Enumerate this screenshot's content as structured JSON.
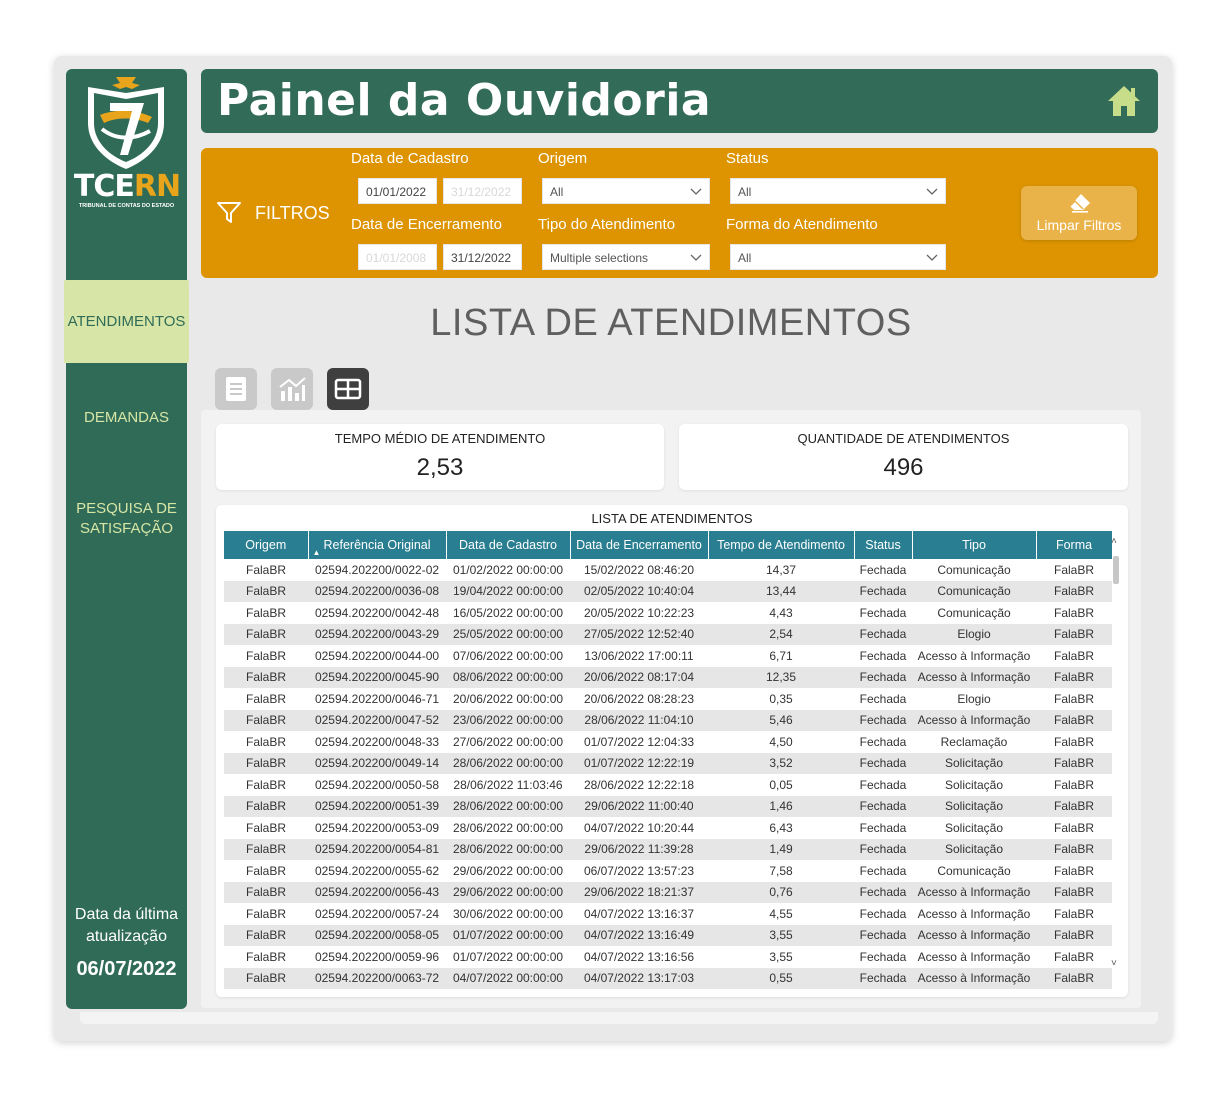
{
  "sidebar": {
    "brand_tce": "TCE",
    "brand_rn": "RN",
    "brand_sub": "TRIBUNAL DE CONTAS DO ESTADO",
    "nav": {
      "atendimentos": "ATENDIMENTOS",
      "demandas": "DEMANDAS",
      "pesquisa_line1": "PESQUISA DE",
      "pesquisa_line2": "SATISFAÇÃO"
    },
    "update_line1": "Data da última",
    "update_line2": "atualização",
    "update_date": "06/07/2022"
  },
  "header": {
    "title": "Painel da Ouvidoria",
    "home_icon": "home-icon"
  },
  "filters": {
    "title": "FILTROS",
    "data_cadastro_label": "Data de Cadastro",
    "data_cadastro_from": "01/01/2022",
    "data_cadastro_to": "31/12/2022",
    "data_encerramento_label": "Data de Encerramento",
    "data_encerramento_from": "01/01/2008",
    "data_encerramento_to": "31/12/2022",
    "origem_label": "Origem",
    "origem_value": "All",
    "tipo_label": "Tipo do Atendimento",
    "tipo_value": "Multiple selections",
    "status_label": "Status",
    "status_value": "All",
    "forma_label": "Forma do Atendimento",
    "forma_value": "All",
    "clear_button": "Limpar Filtros"
  },
  "page_title": "LISTA DE ATENDIMENTOS",
  "kpis": {
    "tempo_label": "TEMPO MÉDIO DE ATENDIMENTO",
    "tempo_value": "2,53",
    "quantidade_label": "QUANTIDADE DE ATENDIMENTOS",
    "quantidade_value": "496"
  },
  "table": {
    "title": "LISTA DE ATENDIMENTOS",
    "columns": [
      "Origem",
      "Referência Original",
      "Data de Cadastro",
      "Data de Encerramento",
      "Tempo de Atendimento",
      "Status",
      "Tipo",
      "Forma"
    ],
    "rows": [
      [
        "FalaBR",
        "02594.202200/0022-02",
        "01/02/2022 00:00:00",
        "15/02/2022 08:46:20",
        "14,37",
        "Fechada",
        "Comunicação",
        "FalaBR"
      ],
      [
        "FalaBR",
        "02594.202200/0036-08",
        "19/04/2022 00:00:00",
        "02/05/2022 10:40:04",
        "13,44",
        "Fechada",
        "Comunicação",
        "FalaBR"
      ],
      [
        "FalaBR",
        "02594.202200/0042-48",
        "16/05/2022 00:00:00",
        "20/05/2022 10:22:23",
        "4,43",
        "Fechada",
        "Comunicação",
        "FalaBR"
      ],
      [
        "FalaBR",
        "02594.202200/0043-29",
        "25/05/2022 00:00:00",
        "27/05/2022 12:52:40",
        "2,54",
        "Fechada",
        "Elogio",
        "FalaBR"
      ],
      [
        "FalaBR",
        "02594.202200/0044-00",
        "07/06/2022 00:00:00",
        "13/06/2022 17:00:11",
        "6,71",
        "Fechada",
        "Acesso à Informação",
        "FalaBR"
      ],
      [
        "FalaBR",
        "02594.202200/0045-90",
        "08/06/2022 00:00:00",
        "20/06/2022 08:17:04",
        "12,35",
        "Fechada",
        "Acesso à Informação",
        "FalaBR"
      ],
      [
        "FalaBR",
        "02594.202200/0046-71",
        "20/06/2022 00:00:00",
        "20/06/2022 08:28:23",
        "0,35",
        "Fechada",
        "Elogio",
        "FalaBR"
      ],
      [
        "FalaBR",
        "02594.202200/0047-52",
        "23/06/2022 00:00:00",
        "28/06/2022 11:04:10",
        "5,46",
        "Fechada",
        "Acesso à Informação",
        "FalaBR"
      ],
      [
        "FalaBR",
        "02594.202200/0048-33",
        "27/06/2022 00:00:00",
        "01/07/2022 12:04:33",
        "4,50",
        "Fechada",
        "Reclamação",
        "FalaBR"
      ],
      [
        "FalaBR",
        "02594.202200/0049-14",
        "28/06/2022 00:00:00",
        "01/07/2022 12:22:19",
        "3,52",
        "Fechada",
        "Solicitação",
        "FalaBR"
      ],
      [
        "FalaBR",
        "02594.202200/0050-58",
        "28/06/2022 11:03:46",
        "28/06/2022 12:22:18",
        "0,05",
        "Fechada",
        "Solicitação",
        "FalaBR"
      ],
      [
        "FalaBR",
        "02594.202200/0051-39",
        "28/06/2022 00:00:00",
        "29/06/2022 11:00:40",
        "1,46",
        "Fechada",
        "Solicitação",
        "FalaBR"
      ],
      [
        "FalaBR",
        "02594.202200/0053-09",
        "28/06/2022 00:00:00",
        "04/07/2022 10:20:44",
        "6,43",
        "Fechada",
        "Solicitação",
        "FalaBR"
      ],
      [
        "FalaBR",
        "02594.202200/0054-81",
        "28/06/2022 00:00:00",
        "29/06/2022 11:39:28",
        "1,49",
        "Fechada",
        "Solicitação",
        "FalaBR"
      ],
      [
        "FalaBR",
        "02594.202200/0055-62",
        "29/06/2022 00:00:00",
        "06/07/2022 13:57:23",
        "7,58",
        "Fechada",
        "Comunicação",
        "FalaBR"
      ],
      [
        "FalaBR",
        "02594.202200/0056-43",
        "29/06/2022 00:00:00",
        "29/06/2022 18:21:37",
        "0,76",
        "Fechada",
        "Acesso à Informação",
        "FalaBR"
      ],
      [
        "FalaBR",
        "02594.202200/0057-24",
        "30/06/2022 00:00:00",
        "04/07/2022 13:16:37",
        "4,55",
        "Fechada",
        "Acesso à Informação",
        "FalaBR"
      ],
      [
        "FalaBR",
        "02594.202200/0058-05",
        "01/07/2022 00:00:00",
        "04/07/2022 13:16:49",
        "3,55",
        "Fechada",
        "Acesso à Informação",
        "FalaBR"
      ],
      [
        "FalaBR",
        "02594.202200/0059-96",
        "01/07/2022 00:00:00",
        "04/07/2022 13:16:56",
        "3,55",
        "Fechada",
        "Acesso à Informação",
        "FalaBR"
      ],
      [
        "FalaBR",
        "02594.202200/0063-72",
        "04/07/2022 00:00:00",
        "04/07/2022 13:17:03",
        "0,55",
        "Fechada",
        "Acesso à Informação",
        "FalaBR"
      ]
    ]
  },
  "colors": {
    "sidebar": "#2f6b57",
    "header": "#336b59",
    "filters": "#dd9400",
    "nav_active": "#d7e6a6",
    "table_header": "#2a7e91"
  }
}
